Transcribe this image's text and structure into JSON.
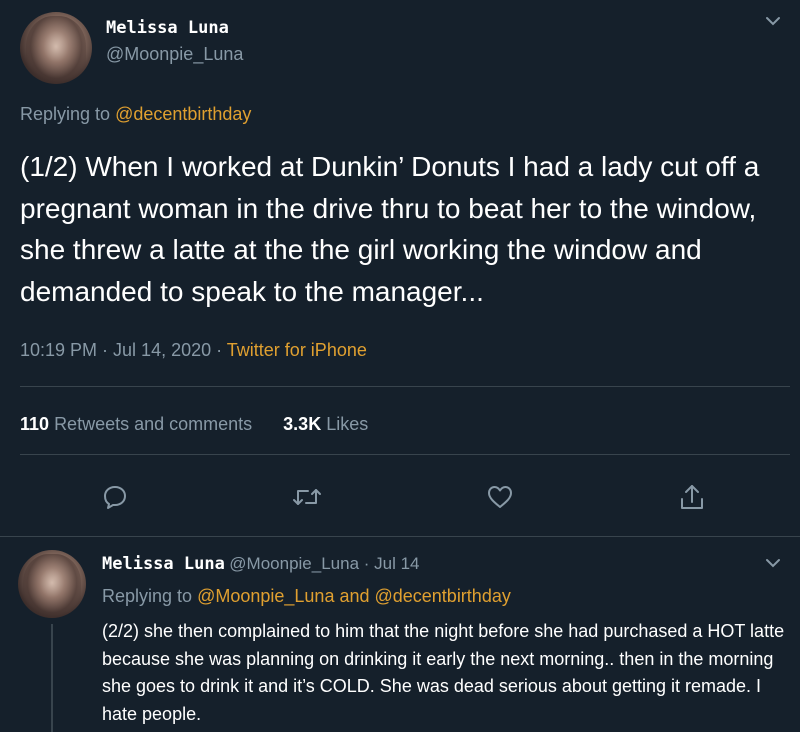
{
  "main_tweet": {
    "author_name": "Melissa Luna",
    "author_handle": "@Moonpie_Luna",
    "replying_label": "Replying to",
    "replying_to": "@decentbirthday",
    "text": "(1/2) When I worked at Dunkin’ Donuts I had a lady cut off a pregnant woman in the drive thru to beat her to the window, she threw a latte at the the girl working the window and demanded to speak to the manager...",
    "time": "10:19 PM · Jul 14, 2020 · ",
    "source": "Twitter for iPhone",
    "retweets_count": "110",
    "retweets_label": "Retweets and comments",
    "likes_count": "3.3K",
    "likes_label": "Likes"
  },
  "actions": {
    "icons": [
      "reply-icon",
      "retweet-icon",
      "like-icon",
      "share-icon"
    ]
  },
  "reply_tweet": {
    "author_name": "Melissa Luna",
    "meta": "@Moonpie_Luna · Jul 14",
    "replying_label": "Replying to",
    "replying_to": "@Moonpie_Luna and @decentbirthday",
    "text": "(2/2) she then complained to him that the night before she had purchased a HOT latte because she was planning on drinking it early the next morning.. then in the morning she goes to drink it and it’s COLD. She was dead serious about getting it remade. I hate people."
  },
  "colors": {
    "background": "#15202b",
    "accent": "#e0a030",
    "muted": "#8899a6",
    "divider": "#38444d"
  }
}
